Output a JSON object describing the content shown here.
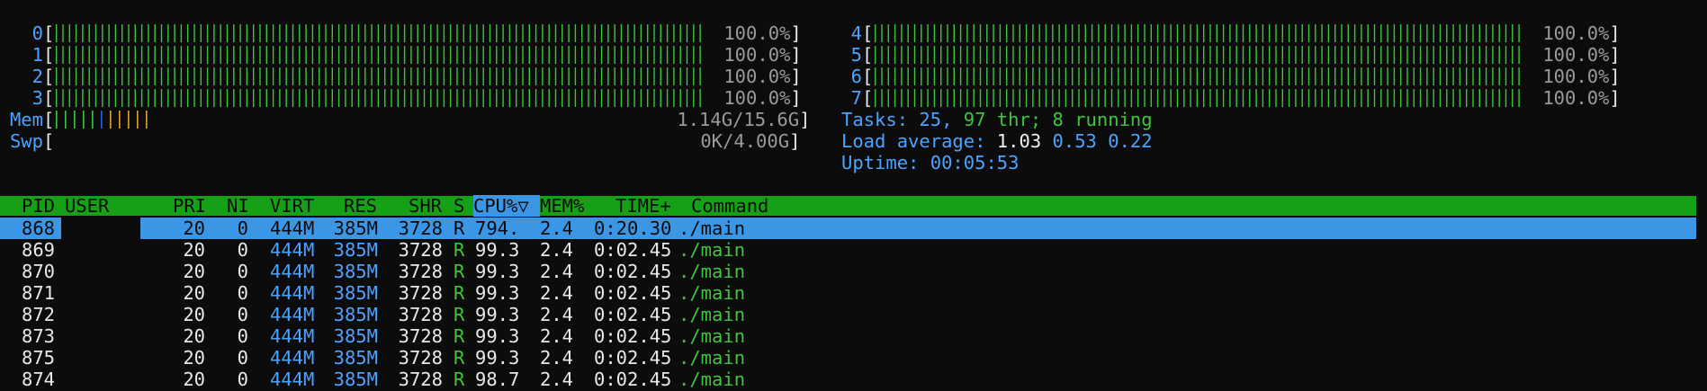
{
  "cpus": [
    {
      "id": "0",
      "percent": 100.0,
      "label": "100.0%"
    },
    {
      "id": "1",
      "percent": 100.0,
      "label": "100.0%"
    },
    {
      "id": "2",
      "percent": 100.0,
      "label": "100.0%"
    },
    {
      "id": "3",
      "percent": 100.0,
      "label": "100.0%"
    },
    {
      "id": "4",
      "percent": 100.0,
      "label": "100.0%"
    },
    {
      "id": "5",
      "percent": 100.0,
      "label": "100.0%"
    },
    {
      "id": "6",
      "percent": 100.0,
      "label": "100.0%"
    },
    {
      "id": "7",
      "percent": 100.0,
      "label": "100.0%"
    }
  ],
  "mem": {
    "label": "Mem",
    "text": "1.14G/15.6G"
  },
  "swp": {
    "label": "Swp",
    "text": "0K/4.00G"
  },
  "tasks": {
    "label": "Tasks:",
    "count": "25,",
    "threads": "97",
    "thr_label": "thr;",
    "running": "8",
    "running_label": "running"
  },
  "load": {
    "label": "Load average:",
    "v1": "1.03",
    "v5": "0.53",
    "v15": "0.22"
  },
  "uptime": {
    "label": "Uptime:",
    "value": "00:05:53"
  },
  "columns": {
    "pid": "PID",
    "user": "USER",
    "pri": "PRI",
    "ni": "NI",
    "virt": "VIRT",
    "res": "RES",
    "shr": "SHR",
    "s": "S",
    "cpu": "CPU%",
    "sort_indicator": "▽",
    "mem": "MEM%",
    "time": "TIME+",
    "command": "Command"
  },
  "processes": [
    {
      "pid": "868",
      "user": "",
      "pri": "20",
      "ni": "0",
      "virt": "444M",
      "res": "385M",
      "shr": "3728",
      "s": "R",
      "cpu": "794.",
      "mem": "2.4",
      "time": "0:20.30",
      "command": "./main"
    },
    {
      "pid": "869",
      "user": "",
      "pri": "20",
      "ni": "0",
      "virt": "444M",
      "res": "385M",
      "shr": "3728",
      "s": "R",
      "cpu": "99.3",
      "mem": "2.4",
      "time": "0:02.45",
      "command": "./main"
    },
    {
      "pid": "870",
      "user": "",
      "pri": "20",
      "ni": "0",
      "virt": "444M",
      "res": "385M",
      "shr": "3728",
      "s": "R",
      "cpu": "99.3",
      "mem": "2.4",
      "time": "0:02.45",
      "command": "./main"
    },
    {
      "pid": "871",
      "user": "",
      "pri": "20",
      "ni": "0",
      "virt": "444M",
      "res": "385M",
      "shr": "3728",
      "s": "R",
      "cpu": "99.3",
      "mem": "2.4",
      "time": "0:02.45",
      "command": "./main"
    },
    {
      "pid": "872",
      "user": "",
      "pri": "20",
      "ni": "0",
      "virt": "444M",
      "res": "385M",
      "shr": "3728",
      "s": "R",
      "cpu": "99.3",
      "mem": "2.4",
      "time": "0:02.45",
      "command": "./main"
    },
    {
      "pid": "873",
      "user": "",
      "pri": "20",
      "ni": "0",
      "virt": "444M",
      "res": "385M",
      "shr": "3728",
      "s": "R",
      "cpu": "99.3",
      "mem": "2.4",
      "time": "0:02.45",
      "command": "./main"
    },
    {
      "pid": "875",
      "user": "",
      "pri": "20",
      "ni": "0",
      "virt": "444M",
      "res": "385M",
      "shr": "3728",
      "s": "R",
      "cpu": "99.3",
      "mem": "2.4",
      "time": "0:02.45",
      "command": "./main"
    },
    {
      "pid": "874",
      "user": "",
      "pri": "20",
      "ni": "0",
      "virt": "444M",
      "res": "385M",
      "shr": "3728",
      "s": "R",
      "cpu": "98.7",
      "mem": "2.4",
      "time": "0:02.45",
      "command": "./main"
    }
  ],
  "colors": {
    "bar_green": "#3ec43e",
    "header_green": "#16a016",
    "selection_blue": "#3b96e6",
    "label_blue": "#4aa3ff"
  }
}
